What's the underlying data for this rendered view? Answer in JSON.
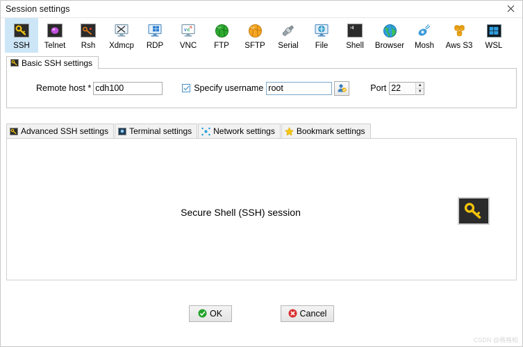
{
  "window": {
    "title": "Session settings",
    "close_label": "✕"
  },
  "toolbar": {
    "items": [
      {
        "label": "SSH",
        "icon": "ssh-key-icon",
        "selected": true
      },
      {
        "label": "Telnet",
        "icon": "telnet-icon",
        "selected": false
      },
      {
        "label": "Rsh",
        "icon": "rsh-icon",
        "selected": false
      },
      {
        "label": "Xdmcp",
        "icon": "xdmcp-icon",
        "selected": false
      },
      {
        "label": "RDP",
        "icon": "rdp-icon",
        "selected": false
      },
      {
        "label": "VNC",
        "icon": "vnc-icon",
        "selected": false
      },
      {
        "label": "FTP",
        "icon": "ftp-globe-icon",
        "selected": false
      },
      {
        "label": "SFTP",
        "icon": "sftp-globe-icon",
        "selected": false
      },
      {
        "label": "Serial",
        "icon": "serial-plug-icon",
        "selected": false
      },
      {
        "label": "File",
        "icon": "file-share-icon",
        "selected": false
      },
      {
        "label": "Shell",
        "icon": "shell-icon",
        "selected": false
      },
      {
        "label": "Browser",
        "icon": "browser-icon",
        "selected": false
      },
      {
        "label": "Mosh",
        "icon": "mosh-icon",
        "selected": false
      },
      {
        "label": "Aws S3",
        "icon": "aws-s3-icon",
        "selected": false
      },
      {
        "label": "WSL",
        "icon": "wsl-icon",
        "selected": false
      }
    ]
  },
  "basic_settings": {
    "group_title": "Basic SSH settings",
    "remote_host_label": "Remote host *",
    "remote_host_value": "cdh100",
    "specify_username_label": "Specify username",
    "specify_username_checked": true,
    "username_value": "root",
    "username_button_icon": "user-picker-icon",
    "port_label": "Port",
    "port_value": "22",
    "spin_up": "▲",
    "spin_down": "▼"
  },
  "subtabs": [
    {
      "label": "Advanced SSH settings",
      "icon": "ssh-key-icon"
    },
    {
      "label": "Terminal settings",
      "icon": "terminal-icon"
    },
    {
      "label": "Network settings",
      "icon": "network-icon"
    },
    {
      "label": "Bookmark settings",
      "icon": "star-icon"
    }
  ],
  "content": {
    "center_text": "Secure Shell (SSH) session",
    "key_icon": "ssh-key-icon"
  },
  "footer": {
    "ok_label": "OK",
    "cancel_label": "Cancel"
  },
  "watermark": "CSDN @格格柏",
  "colors": {
    "selection": "#cde6f7",
    "ok_green": "#22a329",
    "cancel_red": "#d83030",
    "key_yellow": "#f2c40c",
    "accent_blue": "#4a90c4"
  }
}
